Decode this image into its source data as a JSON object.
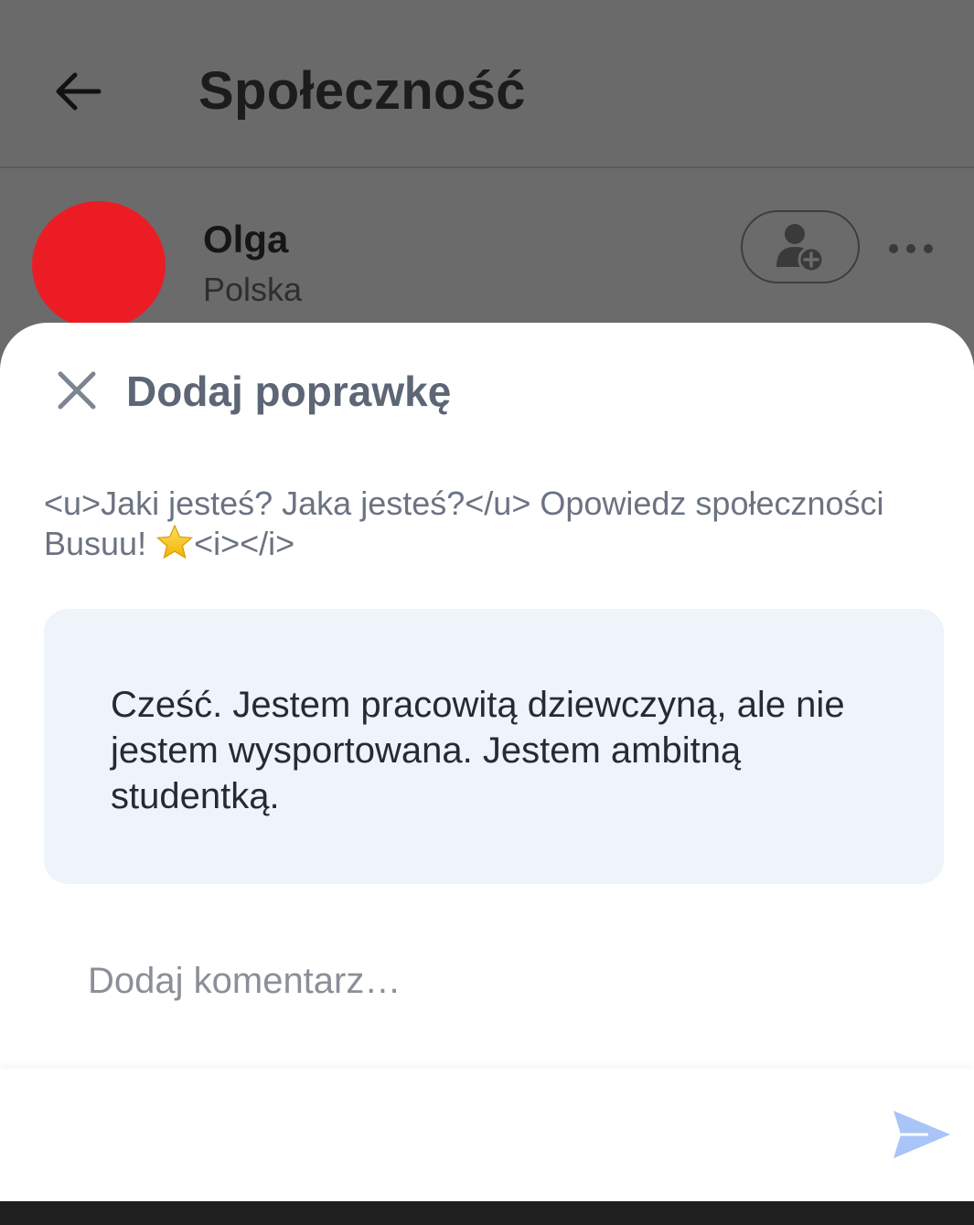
{
  "app_bar": {
    "title": "Społeczność",
    "back_icon": "arrow-left-icon"
  },
  "profile": {
    "name": "Olga",
    "country": "Polska",
    "avatar_color": "#ec1c24",
    "add_friend_icon": "add-user-icon",
    "more_icon": "more-horizontal-icon"
  },
  "sheet": {
    "title": "Dodaj poprawkę",
    "close_icon": "close-icon",
    "prompt_text": "<u>Jaki jesteś? Jaka jesteś?</u> Opowiedz społeczności Busuu! ",
    "prompt_suffix": "<i></i>",
    "prompt_emoji": "star-icon",
    "answer": "Cześć. Jestem pracowitą dziewczyną, ale nie jestem wysportowana. Jestem ambitną studentką.",
    "comment_placeholder": "Dodaj komentarz…",
    "comment_value": "",
    "send_icon": "send-icon"
  },
  "colors": {
    "overlay": "#6b6b6b",
    "sheet_background": "#ffffff",
    "answer_background": "#eff4fb",
    "title_color": "#5d6675",
    "send_color": "#a9c4f7"
  }
}
